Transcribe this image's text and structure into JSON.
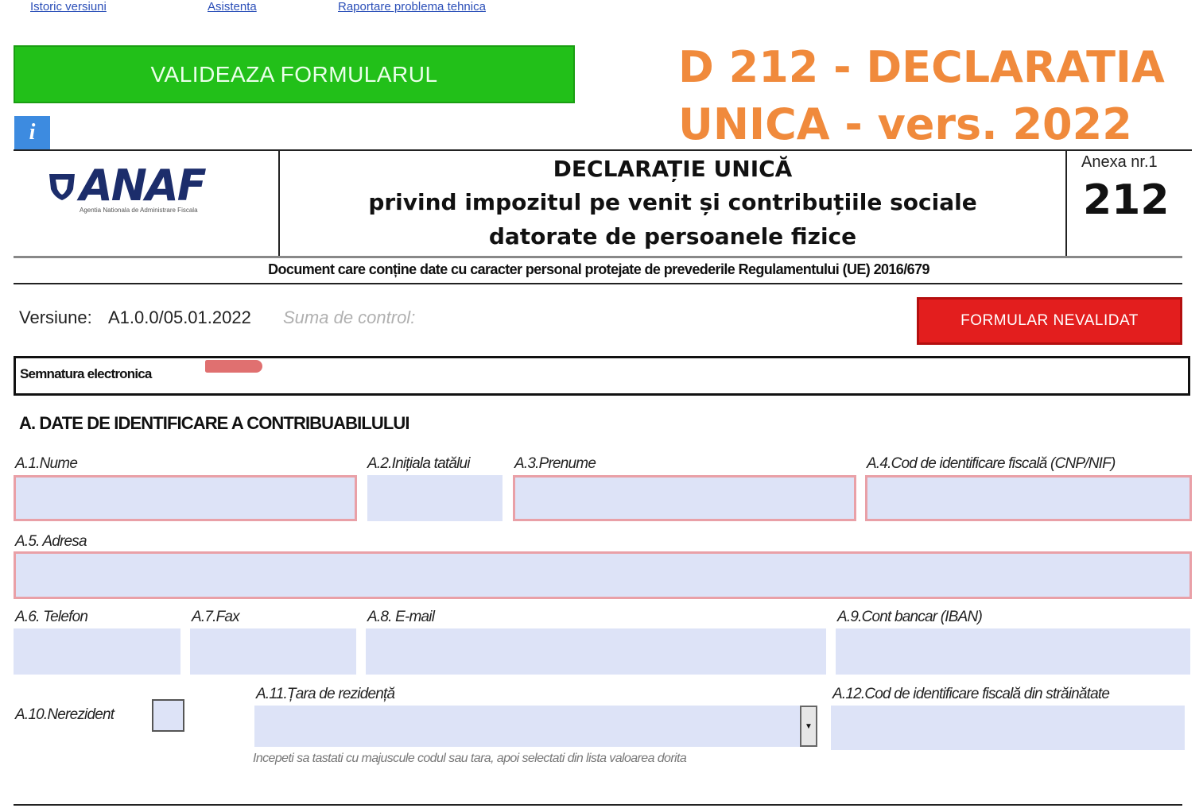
{
  "top_links": {
    "history": "Istoric versiuni",
    "assistance": "Asistenta",
    "report": "Raportare problema tehnica"
  },
  "validate_button": "VALIDEAZA FORMULARUL",
  "info_button": "i",
  "page_title": {
    "line1": "D 212 - DECLARATIA",
    "line2": "UNICA - vers. 2022"
  },
  "logo": {
    "text": "ANAF",
    "subtitle": "Agentia Nationala de Administrare Fiscala"
  },
  "form_header": {
    "line1": "DECLARAȚIE UNICĂ",
    "line2": "privind impozitul pe venit și contribuțiile sociale",
    "line3": "datorate de persoanele fizice",
    "annex_label": "Anexa nr.1",
    "annex_number": "212"
  },
  "gdpr_notice": "Document care conține date cu caracter personal protejate de prevederile Regulamentului (UE) 2016/679",
  "version": {
    "label": "Versiune:",
    "value": "A1.0.0/05.01.2022",
    "checksum_label": "Suma de control:"
  },
  "status_badge": "FORMULAR NEVALIDAT",
  "signature": {
    "label": "Semnatura electronica"
  },
  "section_a": {
    "title": "A. DATE DE IDENTIFICARE A CONTRIBUABILULUI",
    "fields": {
      "name": {
        "label": "A.1.Nume",
        "value": ""
      },
      "father_initial": {
        "label": "A.2.Inițiala tatălui",
        "value": ""
      },
      "surname": {
        "label": "A.3.Prenume",
        "value": ""
      },
      "tax_id": {
        "label": "A.4.Cod de identificare fiscală (CNP/NIF)",
        "value": ""
      },
      "address": {
        "label": "A.5. Adresa",
        "value": ""
      },
      "phone": {
        "label": "A.6. Telefon",
        "value": ""
      },
      "fax": {
        "label": "A.7.Fax",
        "value": ""
      },
      "email": {
        "label": "A.8. E-mail",
        "value": ""
      },
      "iban": {
        "label": "A.9.Cont bancar (IBAN)",
        "value": ""
      },
      "non_resident": {
        "label": "A.10.Nerezident",
        "checked": false
      },
      "residence_country": {
        "label": "A.11.Țara de rezidență",
        "value": ""
      },
      "foreign_tax_id": {
        "label": "A.12.Cod de identificare fiscală din străinătate",
        "value": ""
      }
    },
    "country_hint": "Incepeti sa tastati cu majuscule codul sau tara, apoi selectati din lista valoarea dorita"
  }
}
